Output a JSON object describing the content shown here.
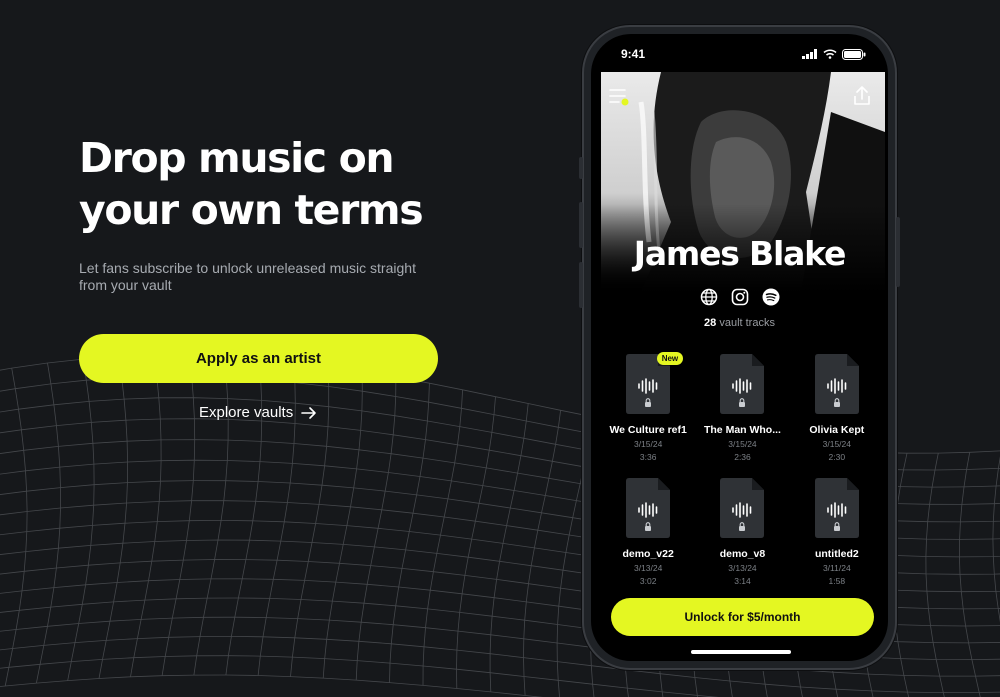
{
  "hero": {
    "title": "Drop music on your own terms",
    "subtitle": "Let fans subscribe to unlock unreleased music straight from your vault",
    "apply_label": "Apply as an artist",
    "explore_label": "Explore vaults"
  },
  "phone": {
    "status_time": "9:41",
    "artist_name": "James Blake",
    "track_count": "28",
    "track_count_suffix": "vault tracks",
    "socials": [
      "globe-icon",
      "instagram-icon",
      "spotify-icon"
    ],
    "tracks": [
      {
        "title": "We Culture ref1",
        "date": "3/15/24",
        "duration": "3:36",
        "badge": "New"
      },
      {
        "title": "The Man Who...",
        "date": "3/15/24",
        "duration": "2:36"
      },
      {
        "title": "Olivia Kept",
        "date": "3/15/24",
        "duration": "2:30"
      },
      {
        "title": "demo_v22",
        "date": "3/13/24",
        "duration": "3:02"
      },
      {
        "title": "demo_v8",
        "date": "3/13/24",
        "duration": "3:14"
      },
      {
        "title": "untitled2",
        "date": "3/11/24",
        "duration": "1:58"
      }
    ],
    "unlock_label": "Unlock for $5/month"
  },
  "colors": {
    "accent": "#e4f722",
    "background": "#16181b"
  }
}
